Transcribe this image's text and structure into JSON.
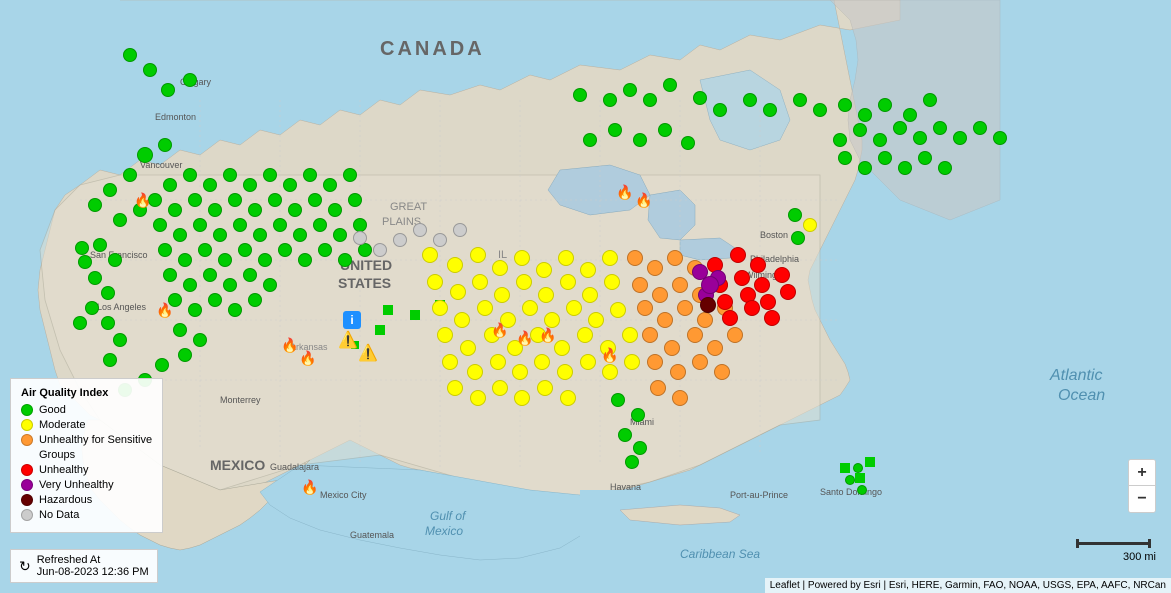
{
  "legend": {
    "title": "Air Quality Index",
    "items": [
      {
        "label": "Good",
        "color": "#00cc00"
      },
      {
        "label": "Moderate",
        "color": "#ffff00"
      },
      {
        "label": "Unhealthy for Sensitive",
        "color": "#ff9933"
      },
      {
        "label": "Groups",
        "color": "#ff9933"
      },
      {
        "label": "Unhealthy",
        "color": "#ff0000"
      },
      {
        "label": "Very Unhealthy",
        "color": "#990099"
      },
      {
        "label": "Hazardous",
        "color": "#660000"
      },
      {
        "label": "No Data",
        "color": "#cccccc"
      }
    ]
  },
  "refresh": {
    "label": "Refreshed At",
    "timestamp": "Jun-08-2023 12:36 PM"
  },
  "zoom": {
    "plus_label": "+",
    "minus_label": "−"
  },
  "scale": {
    "label": "300 mi"
  },
  "attribution": {
    "text": "Leaflet | Powered by Esri | Esri, HERE, Garmin, FAO, NOAA, USGS, EPA, AAFC, NRCan"
  },
  "map": {
    "ocean_color": "#a8d5e8",
    "land_color": "#e8e0d0"
  }
}
